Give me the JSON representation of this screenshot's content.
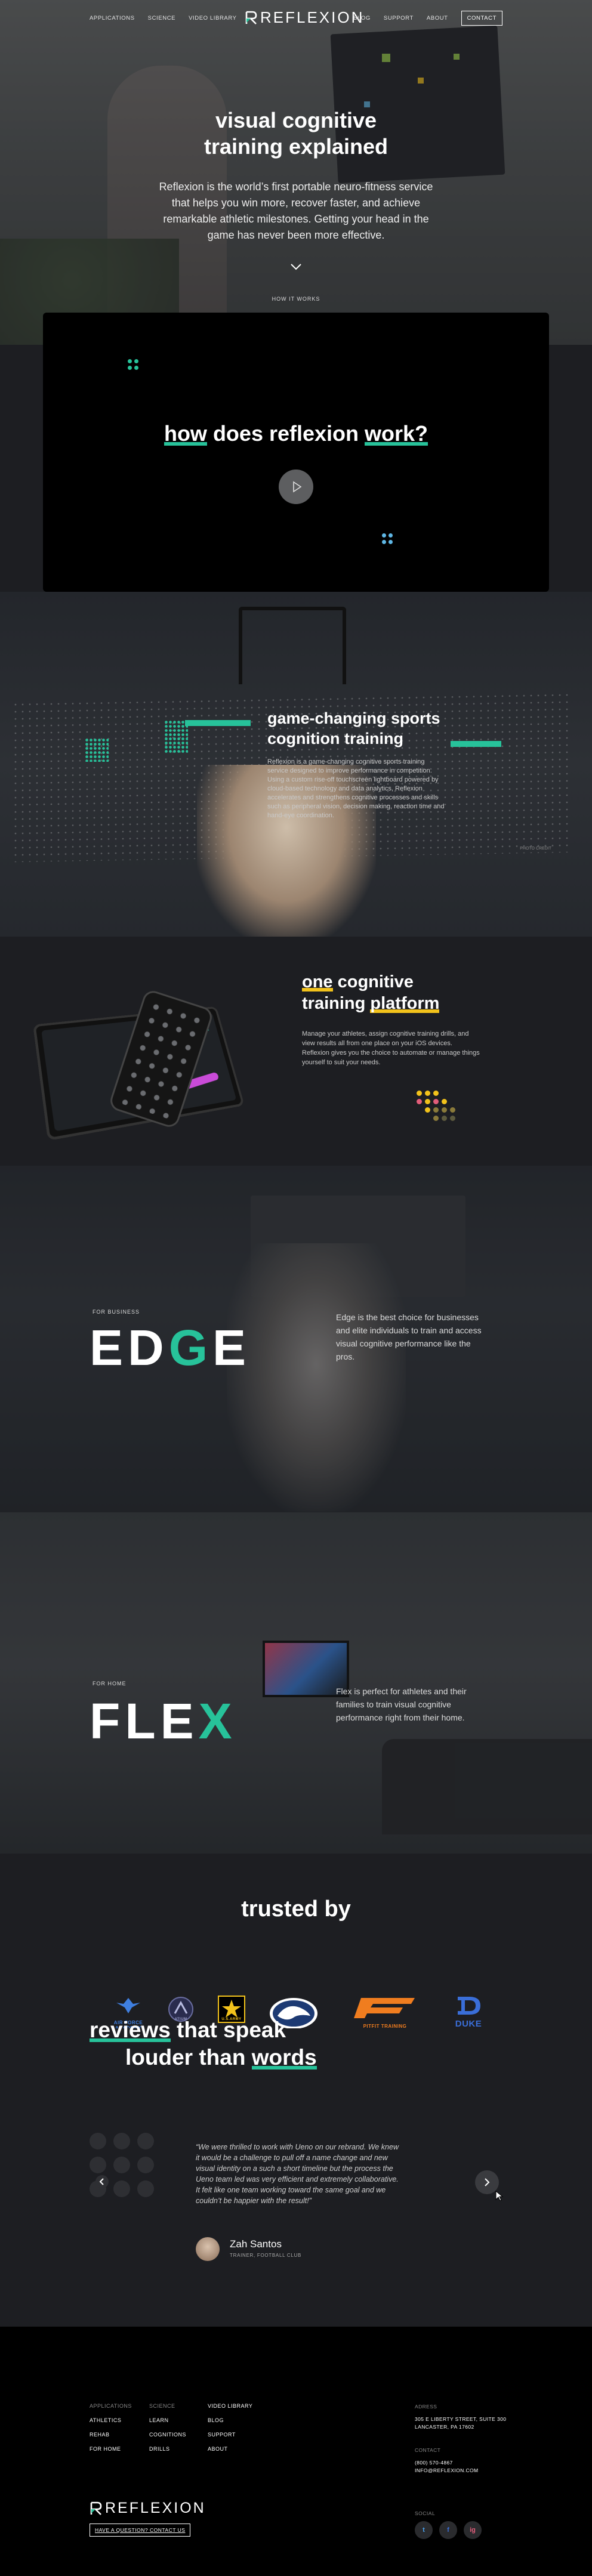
{
  "nav": {
    "left": [
      "APPLICATIONS",
      "SCIENCE",
      "VIDEO LIBRARY"
    ],
    "logo_text": "REFLEXION",
    "right": [
      "BLOG",
      "SUPPORT",
      "ABOUT"
    ],
    "contact": "CONTACT"
  },
  "hero": {
    "title_line1": "visual cognitive",
    "title_line2": "training explained",
    "description": "Reflexion is the world’s first portable neuro-fitness service that helps you win more, recover faster, and achieve remarkable athletic milestones. Getting your head in the game has never been more effective.",
    "cta": "HOW IT WORKS"
  },
  "video": {
    "title_a": "how",
    "title_b": " does reflexion ",
    "title_c": "work?"
  },
  "game": {
    "title_line1": "game-changing sports",
    "title_line2": "cognition training",
    "description": "Reflexion is a game-changing cognitive sports training service designed to improve performance in competition. Using a custom rise-off touchscreen lightboard powered by cloud-based technology and data analytics, Reflexion accelerates and strengthens cognitive processes and skills such as peripheral vision, decision making, reaction time and hand-eye coordination.",
    "tiny": "PHOTO CREDIT"
  },
  "platform": {
    "title_a": "one",
    "title_b": " cognitive",
    "title_c": "training ",
    "title_d": "platform",
    "description": "Manage your athletes, assign cognitive training drills, and view results all from one place on your iOS devices. Reflexion gives you the choice to automate or manage things yourself to suit your needs."
  },
  "edge": {
    "tag": "FOR BUSINESS",
    "letters": [
      "E",
      "D",
      "G",
      "E"
    ],
    "description": "Edge is the best choice for businesses and elite individuals to train and access visual cognitive performance like the pros."
  },
  "flex": {
    "tag": "FOR HOME",
    "letters": [
      "F",
      "L",
      "E",
      "X"
    ],
    "description": "Flex is perfect for athletes and their families to train visual cognitive performance right from their home."
  },
  "trusted": {
    "title": "trusted by",
    "logos": [
      {
        "name": "air-force-academy-logo",
        "caption": "AIR FORCE ACADEMY"
      },
      {
        "name": "atium-logo",
        "caption": "ATIUM"
      },
      {
        "name": "us-army-logo",
        "caption": "U.S.ARMY"
      },
      {
        "name": "penn-state-logo",
        "caption": ""
      },
      {
        "name": "pitfit-training-logo",
        "caption": "PITFIT TRAINING"
      },
      {
        "name": "duke-logo",
        "caption": "DUKE"
      }
    ]
  },
  "reviews": {
    "title_a": "reviews",
    "title_b": " that speak",
    "title_c": "louder than ",
    "title_d": "words",
    "quote": "“We were thrilled to work with Ueno on our rebrand. We knew it would be a challenge to pull off a name change and new visual identity on a such a short timeline but the process the Ueno team led was very efficient and extremely collaborative. It felt like one team working toward the same goal and we couldn’t be happier with the result!”",
    "name": "Zah Santos",
    "role": "TRAINER, FOOTBALL CLUB"
  },
  "footer": {
    "col1": [
      "APPLICATIONS",
      "ATHLETICS",
      "REHAB",
      "FOR HOME"
    ],
    "col2": [
      "SCIENCE",
      "LEARN",
      "COGNITIONS",
      "DRILLS"
    ],
    "col3": [
      "VIDEO LIBRARY",
      "BLOG",
      "SUPPORT",
      "ABOUT"
    ],
    "address_head": "ADRESS",
    "address_1": "305 E LIBERTY STREET, SUITE 300",
    "address_2": "LANCASTER, PA 17602",
    "contact_head": "CONTACT",
    "phone": "(800) 570-4867",
    "email": "INFO@REFLEXION.COM",
    "logo_text": "REFLEXION",
    "question_btn": "HAVE A QUESTION? CONTACT US",
    "social_head": "SOCIAL",
    "social": [
      "t",
      "f",
      "ig"
    ]
  },
  "colors": {
    "accent_green": "#27c29a",
    "accent_yellow": "#f2c21b",
    "background": "#1d1e22"
  }
}
